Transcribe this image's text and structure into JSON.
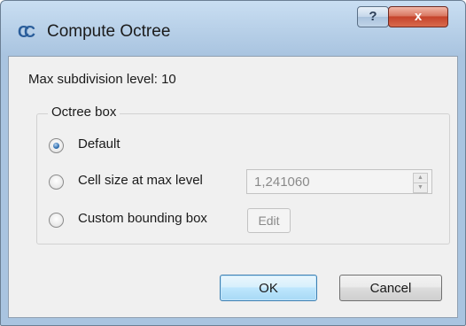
{
  "window": {
    "title": "Compute Octree",
    "app_icon": "CC"
  },
  "titlebar_buttons": {
    "help": "?",
    "close": "x"
  },
  "dialog": {
    "max_level_label": "Max subdivision level: 10",
    "group_title": "Octree box",
    "options": [
      {
        "label": "Default",
        "checked": true
      },
      {
        "label": "Cell size at max level",
        "checked": false
      },
      {
        "label": "Custom bounding box",
        "checked": false
      }
    ],
    "cell_size_value": "1,241060",
    "edit_label": "Edit"
  },
  "buttons": {
    "ok": "OK",
    "cancel": "Cancel"
  },
  "colors": {
    "accent": "#3c7fb1",
    "close": "#c5432b",
    "frame": "#a9c4e0"
  }
}
